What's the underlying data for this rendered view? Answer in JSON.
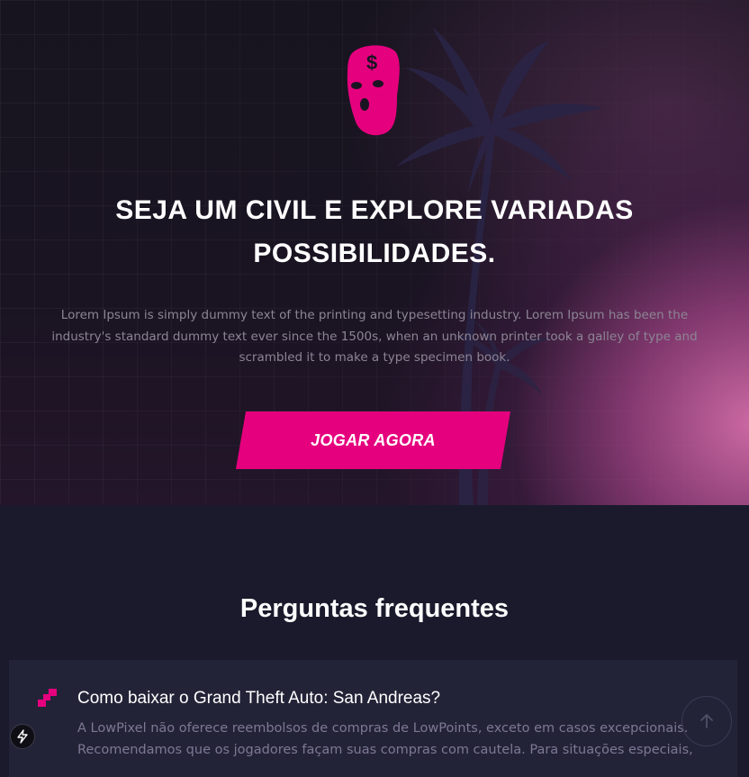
{
  "hero": {
    "title_line1": "SEJA UM CIVIL E EXPLORE VARIADAS",
    "title_line2": "POSSIBILIDADES.",
    "description": "Lorem Ipsum is simply dummy text of the printing and typesetting industry. Lorem Ipsum has been the industry's standard dummy text ever since the 1500s, when an unknown printer took a galley of type and scrambled it to make a type specimen book.",
    "cta_label": "JOGAR AGORA",
    "logo_icon": "ski-mask-dollar-icon",
    "background_icon": "palm-trees-icon"
  },
  "faq": {
    "title": "Perguntas frequentes",
    "items": [
      {
        "question": "Como baixar o Grand Theft Auto: San Andreas?",
        "answer": "A LowPixel não oferece reembolsos de compras de LowPoints, exceto em casos excepcionais. Recomendamos que os jogadores façam suas compras com cautela. Para situações especiais,",
        "icon": "pixel-stairs-icon"
      }
    ]
  },
  "floating": {
    "scroll_top_icon": "arrow-up-icon",
    "badge_icon": "bolt-icon"
  },
  "colors": {
    "accent": "#e5007e",
    "background": "#1a1a2c",
    "card": "#232338",
    "muted_text": "#8c8594"
  }
}
